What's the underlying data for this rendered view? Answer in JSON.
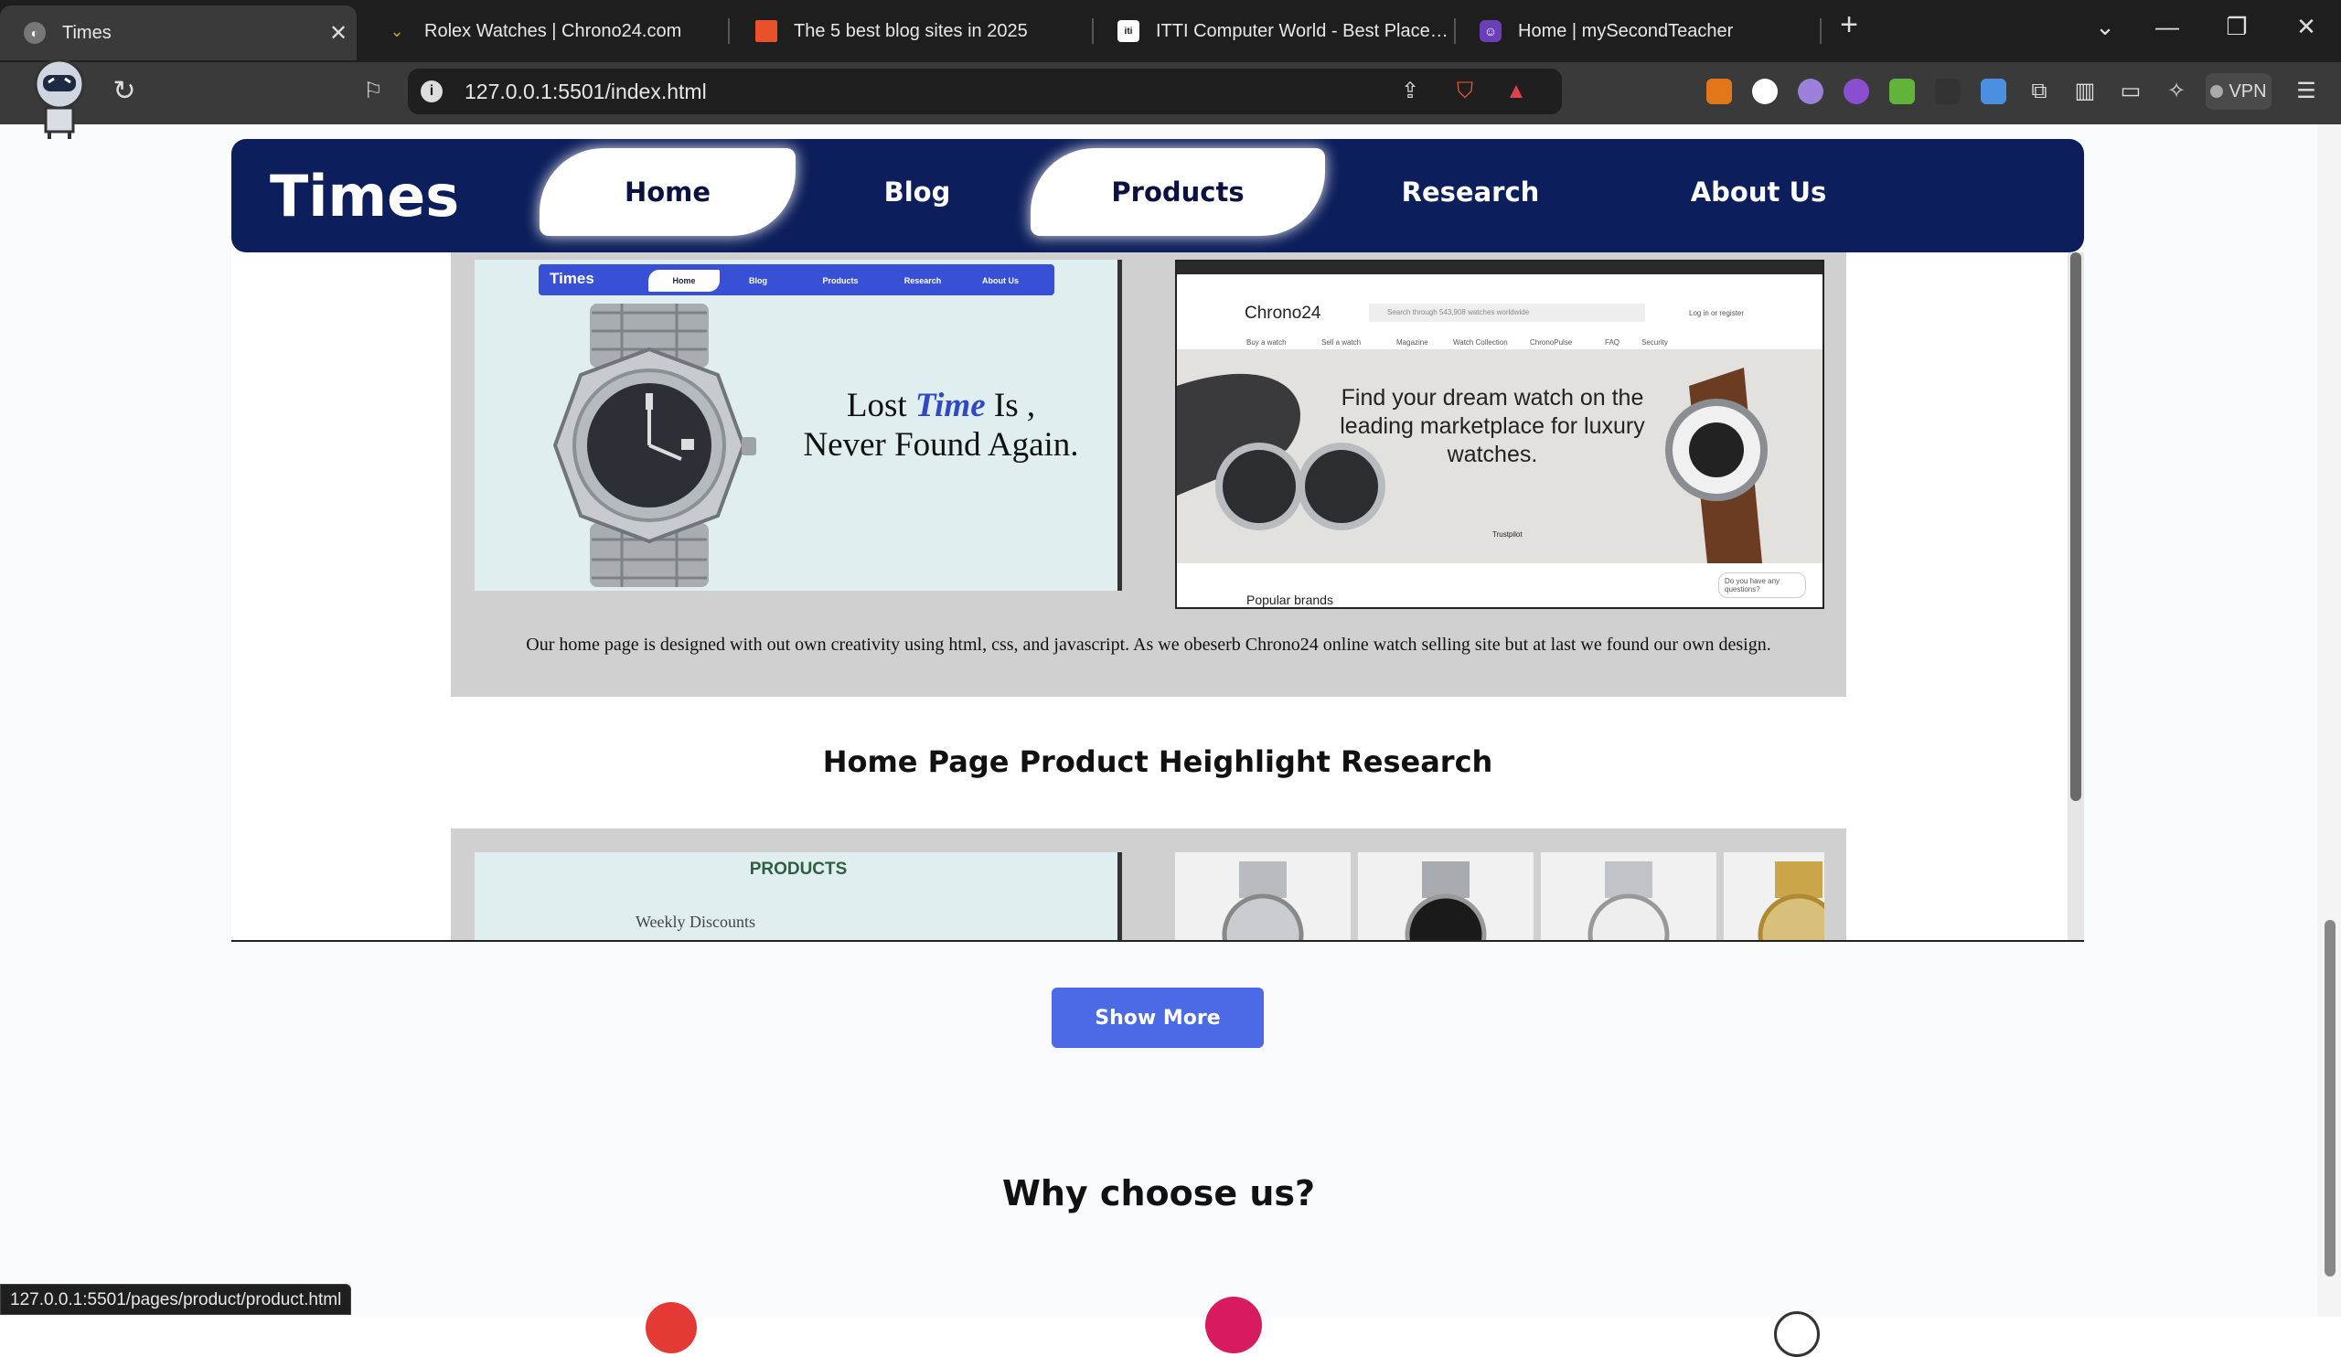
{
  "browser": {
    "tabs": [
      {
        "title": "Times",
        "active": true
      },
      {
        "title": "Rolex Watches | Chrono24.com",
        "active": false
      },
      {
        "title": "The 5 best blog sites in 2025",
        "active": false
      },
      {
        "title": "ITTI Computer World - Best Place To Bu",
        "active": false
      },
      {
        "title": "Home | mySecondTeacher",
        "active": false
      }
    ],
    "url": "127.0.0.1:5501/index.html",
    "vpn_label": "VPN",
    "status_url": "127.0.0.1:5501/pages/product/product.html"
  },
  "site": {
    "logo": "Times",
    "nav": [
      "Home",
      "Blog",
      "Products",
      "Research",
      "About Us"
    ]
  },
  "research": {
    "mini_site": {
      "logo": "Times",
      "nav": [
        "Home",
        "Blog",
        "Products",
        "Research",
        "About Us"
      ],
      "tagline_1": "Lost",
      "tagline_em": "Time",
      "tagline_2": "Is ,",
      "tagline_3": "Never Found Again."
    },
    "chrono": {
      "logo": "Chrono24",
      "search_placeholder": "Search through 543,908 watches worldwide",
      "login": "Log in or register",
      "menu": [
        "Buy a watch",
        "Sell a watch",
        "Magazine",
        "Watch Collection",
        "ChronoPulse",
        "FAQ",
        "Security"
      ],
      "hero_text": "Find your dream watch on the leading marketplace for luxury watches.",
      "trustpilot": "Trustpilot",
      "popular": "Popular brands",
      "help": "Do you have any questions?"
    },
    "caption": "Our home page is designed with out own creativity using html, css, and javascript. As we obeserb Chrono24 online watch selling site but at last we found our own design.",
    "heading2": "Home Page Product Heighlight Research",
    "products_shot": {
      "title": "PRODUCTS",
      "sub": "Weekly Discounts"
    }
  },
  "show_more": "Show More",
  "why_title": "Why choose us?"
}
